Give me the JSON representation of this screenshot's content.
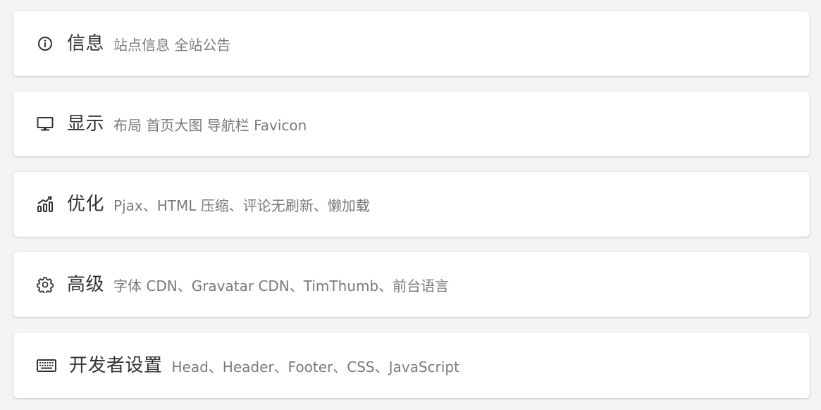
{
  "settings_cards": [
    {
      "title": "信息",
      "desc": "站点信息 全站公告",
      "icon": "info-circle-icon"
    },
    {
      "title": "显示",
      "desc": "布局 首页大图 导航栏 Favicon",
      "icon": "monitor-icon"
    },
    {
      "title": "优化",
      "desc": "Pjax、HTML 压缩、评论无刷新、懒加载",
      "icon": "chart-growth-icon"
    },
    {
      "title": "高级",
      "desc": "字体 CDN、Gravatar CDN、TimThumb、前台语言",
      "icon": "gear-icon"
    },
    {
      "title": "开发者设置",
      "desc": "Head、Header、Footer、CSS、JavaScript",
      "icon": "keyboard-icon"
    }
  ]
}
